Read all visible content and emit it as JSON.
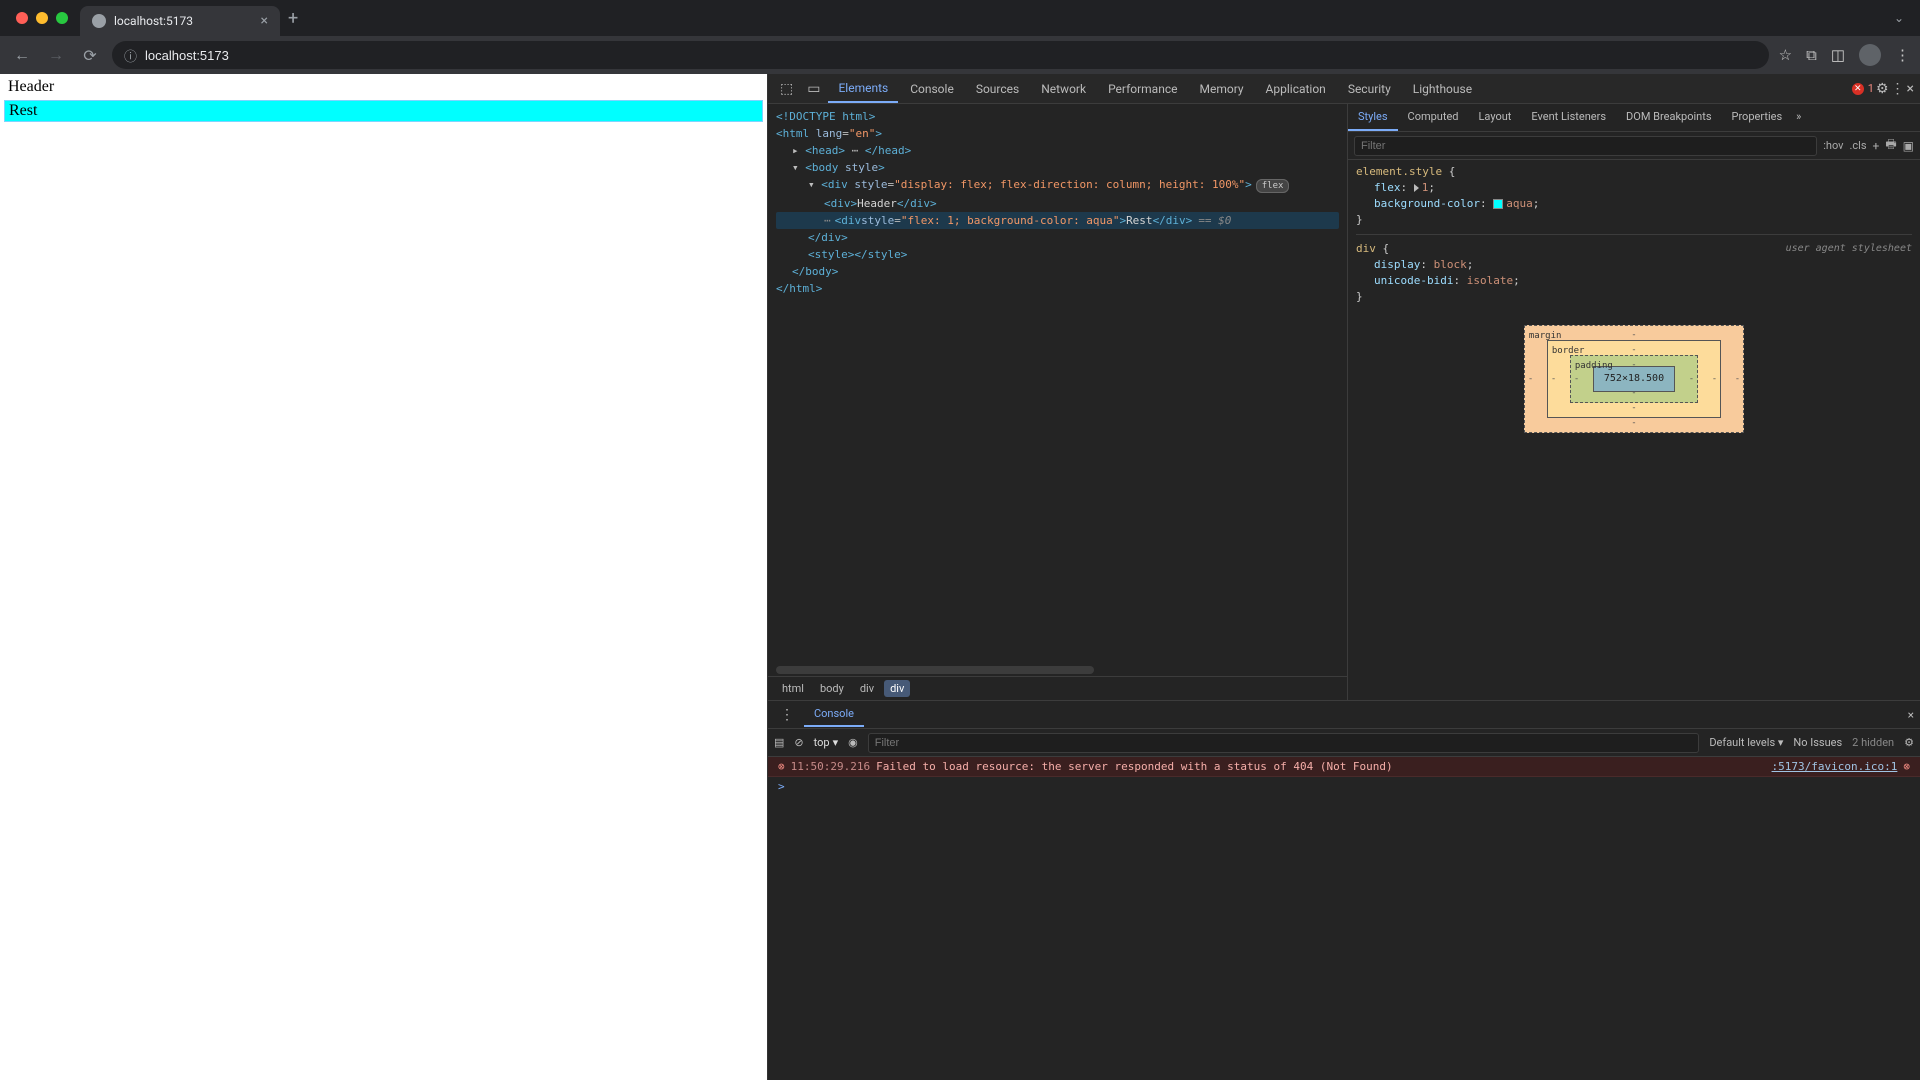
{
  "browser": {
    "tab_title": "localhost:5173",
    "address": "localhost:5173"
  },
  "page": {
    "header_text": "Header",
    "rest_text": "Rest"
  },
  "devtools": {
    "tabs": [
      "Elements",
      "Console",
      "Sources",
      "Network",
      "Performance",
      "Memory",
      "Application",
      "Security",
      "Lighthouse"
    ],
    "active_tab": "Elements",
    "error_count": "1",
    "dom": {
      "doctype": "<!DOCTYPE html>",
      "html_open": "<html lang=\"en\">",
      "head_line": "<head>  </head>",
      "body_open": "<body style>",
      "flex_div": {
        "open_prefix": "<div style=\"",
        "style_value": "display: flex; flex-direction: column; height: 100%",
        "open_suffix": "\">",
        "pill": "flex"
      },
      "header_div": "<div>Header</div>",
      "rest_div": {
        "open_prefix": "<div style=\"",
        "style_value": "flex: 1; background-color: aqua",
        "open_suffix": "\">",
        "text": "Rest",
        "close": "</div>",
        "eq0": "== $0"
      },
      "close_flex": "</div>",
      "style_tag": "<style></style>",
      "close_body": "</body>",
      "close_html": "</html>"
    },
    "breadcrumbs": [
      "html",
      "body",
      "div",
      "div"
    ],
    "styles": {
      "tabs": [
        "Styles",
        "Computed",
        "Layout",
        "Event Listeners",
        "DOM Breakpoints",
        "Properties"
      ],
      "active_tab": "Styles",
      "filter_placeholder": "Filter",
      "hov": ":hov",
      "cls": ".cls",
      "rule1": {
        "selector": "element.style",
        "props": [
          {
            "name": "flex",
            "value": "1",
            "tri": true
          },
          {
            "name": "background-color",
            "value": "aqua",
            "swatch": true
          }
        ]
      },
      "rule2": {
        "selector": "div",
        "ua": "user agent stylesheet",
        "props": [
          {
            "name": "display",
            "value": "block"
          },
          {
            "name": "unicode-bidi",
            "value": "isolate"
          }
        ]
      },
      "box_model": {
        "margin_label": "margin",
        "border_label": "border",
        "padding_label": "padding",
        "content": "752×18.500"
      }
    },
    "console_drawer": {
      "tab": "Console",
      "top": "top",
      "filter_placeholder": "Filter",
      "levels": "Default levels",
      "no_issues": "No Issues",
      "hidden": "2 hidden",
      "log": {
        "time": "11:50:29.216",
        "msg": "Failed to load resource: the server responded with a status of 404 (Not Found)",
        "src": ":5173/favicon.ico:1"
      },
      "prompt": ">"
    }
  }
}
